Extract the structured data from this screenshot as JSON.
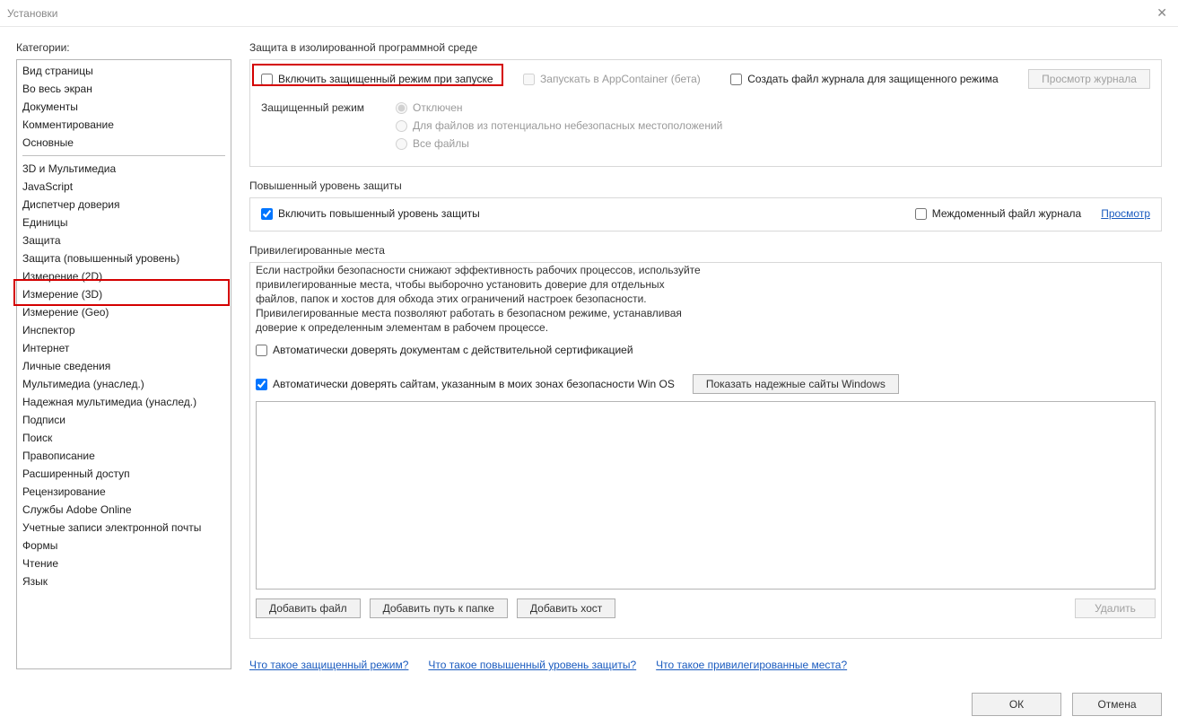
{
  "window": {
    "title": "Установки"
  },
  "categories": {
    "label": "Категории:",
    "group1": [
      "Вид страницы",
      "Во весь экран",
      "Документы",
      "Комментирование",
      "Основные"
    ],
    "group2": [
      "3D и Мультимедиа",
      "JavaScript",
      "Диспетчер доверия",
      "Единицы",
      "Защита",
      "Защита (повышенный уровень)",
      "Измерение (2D)",
      "Измерение (3D)",
      "Измерение (Geo)",
      "Инспектор",
      "Интернет",
      "Личные сведения",
      "Мультимедиа (унаслед.)",
      "Надежная мультимедиа (унаслед.)",
      "Подписи",
      "Поиск",
      "Правописание",
      "Расширенный доступ",
      "Рецензирование",
      "Службы Adobe Online",
      "Учетные записи электронной почты",
      "Формы",
      "Чтение",
      "Язык"
    ]
  },
  "sec1": {
    "title": "Защита в изолированной программной среде",
    "chk_enable": "Включить защищенный режим при запуске",
    "chk_appcontainer": "Запускать в AppContainer (бета)",
    "chk_logfile": "Создать файл журнала для защищенного режима",
    "btn_viewlog": "Просмотр журнала",
    "mode_label": "Защищенный режим",
    "radio_off": "Отключен",
    "radio_unsafe": "Для файлов из потенциально небезопасных местоположений",
    "radio_all": "Все файлы"
  },
  "sec2": {
    "title": "Повышенный уровень защиты",
    "chk_enable": "Включить повышенный уровень защиты",
    "chk_crossdomain": "Междоменный файл журнала",
    "link_view": "Просмотр"
  },
  "sec3": {
    "title": "Привилегированные места",
    "desc": "Если настройки безопасности снижают эффективность рабочих процессов, используйте привилегированные места, чтобы выборочно установить доверие для отдельных файлов, папок и хостов для обхода этих ограничений настроек безопасности. Привилегированные места позволяют работать в безопасном режиме, устанавливая доверие к определенным элементам в рабочем процессе.",
    "chk_cert": "Автоматически доверять документам с действительной сертификацией",
    "chk_winos": "Автоматически доверять сайтам, указанным в моих зонах безопасности Win OS",
    "btn_showsites": "Показать надежные сайты Windows",
    "btn_addfile": "Добавить файл",
    "btn_addfolder": "Добавить путь к папке",
    "btn_addhost": "Добавить хост",
    "btn_delete": "Удалить"
  },
  "links": {
    "l1": "Что такое защищенный режим?",
    "l2": "Что такое повышенный уровень защиты?",
    "l3": "Что такое привилегированные места?"
  },
  "footer": {
    "ok": "ОК",
    "cancel": "Отмена"
  }
}
